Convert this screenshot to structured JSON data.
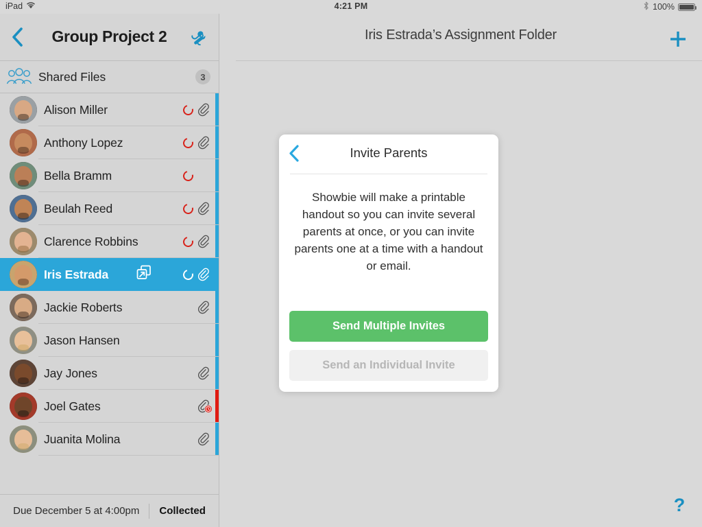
{
  "status_bar": {
    "device": "iPad",
    "wifi_icon": "wifi-icon",
    "time": "4:21 PM",
    "bluetooth_icon": "bluetooth-icon",
    "battery_percent": "100%",
    "battery_icon": "battery-full-icon"
  },
  "sidebar": {
    "back_icon": "chevron-left-icon",
    "title": "Group Project 2",
    "settings_icon": "wrench-icon",
    "shared_files": {
      "icon": "people-group-icon",
      "label": "Shared Files",
      "count": "3"
    },
    "students": [
      {
        "name": "Alison Miller",
        "status_icon": "red-circle-icon",
        "attachment_icon": "paperclip-icon",
        "edge": "blue",
        "selected": false,
        "alert": false,
        "hair": "#2b1d16",
        "skin": "#d8a884",
        "bg": "#9aa0a4"
      },
      {
        "name": "Anthony Lopez",
        "status_icon": "red-circle-icon",
        "attachment_icon": "paperclip-icon",
        "edge": "blue",
        "selected": false,
        "alert": false,
        "hair": "#3a2217",
        "skin": "#c68a5e",
        "bg": "#b06a4a"
      },
      {
        "name": "Bella Bramm",
        "status_icon": "red-circle-icon",
        "attachment_icon": "",
        "edge": "blue",
        "selected": false,
        "alert": false,
        "hair": "#2e1c12",
        "skin": "#bb7f57",
        "bg": "#6f8d7a"
      },
      {
        "name": "Beulah Reed",
        "status_icon": "red-circle-icon",
        "attachment_icon": "paperclip-icon",
        "edge": "blue",
        "selected": false,
        "alert": false,
        "hair": "#241610",
        "skin": "#c08456",
        "bg": "#4f6f93"
      },
      {
        "name": "Clarence Robbins",
        "status_icon": "red-circle-icon",
        "attachment_icon": "paperclip-icon",
        "edge": "blue",
        "selected": false,
        "alert": false,
        "hair": "#8a6134",
        "skin": "#e3b392",
        "bg": "#9c8a6c"
      },
      {
        "name": "Iris Estrada",
        "status_icon": "white-circle-icon",
        "attachment_icon": "paperclip-icon",
        "edge": "blue",
        "selected": true,
        "alert": false,
        "expand_icon": "open-in-new-icon",
        "hair": "#4a2d18",
        "skin": "#d49a6a",
        "bg": "#c8a46e"
      },
      {
        "name": "Jackie Roberts",
        "status_icon": "",
        "attachment_icon": "paperclip-icon",
        "edge": "blue",
        "selected": false,
        "alert": false,
        "hair": "#2c1b11",
        "skin": "#d8ab85",
        "bg": "#7c6a5c"
      },
      {
        "name": "Jason Hansen",
        "status_icon": "",
        "attachment_icon": "",
        "edge": "blue",
        "selected": false,
        "alert": false,
        "hair": "#c9a35e",
        "skin": "#e8c09a",
        "bg": "#8e8f84"
      },
      {
        "name": "Jay Jones",
        "status_icon": "",
        "attachment_icon": "paperclip-icon",
        "edge": "blue",
        "selected": false,
        "alert": false,
        "hair": "#1a1110",
        "skin": "#7a4a2c",
        "bg": "#5d4436"
      },
      {
        "name": "Joel Gates",
        "status_icon": "",
        "attachment_icon": "paperclip-icon",
        "edge": "red",
        "selected": false,
        "alert": true,
        "hair": "#15100e",
        "skin": "#6f452a",
        "bg": "#a33a2a"
      },
      {
        "name": "Juanita Molina",
        "status_icon": "",
        "attachment_icon": "paperclip-icon",
        "edge": "blue",
        "selected": false,
        "alert": false,
        "hair": "#cba765",
        "skin": "#e6bd98",
        "bg": "#8c8f7e"
      }
    ],
    "footer": {
      "due_text": "Due December 5 at 4:00pm",
      "status_label": "Collected"
    }
  },
  "main": {
    "title": "Iris Estrada’s Assignment Folder",
    "add_icon": "plus-icon",
    "help_icon": "question-mark-icon",
    "help_label": "?"
  },
  "modal": {
    "back_icon": "chevron-left-icon",
    "title": "Invite Parents",
    "body": "Showbie will make a printable handout so you can invite several parents at once, or you can invite parents one at a time with a handout or email.",
    "primary_button": "Send Multiple Invites",
    "secondary_button": "Send an Individual Invite"
  },
  "colors": {
    "accent_blue": "#2ba6d9",
    "icon_blue": "#1a8fc1",
    "alert_red": "#e01b12",
    "primary_green": "#5cc16a",
    "background": "#d9d9d9"
  }
}
